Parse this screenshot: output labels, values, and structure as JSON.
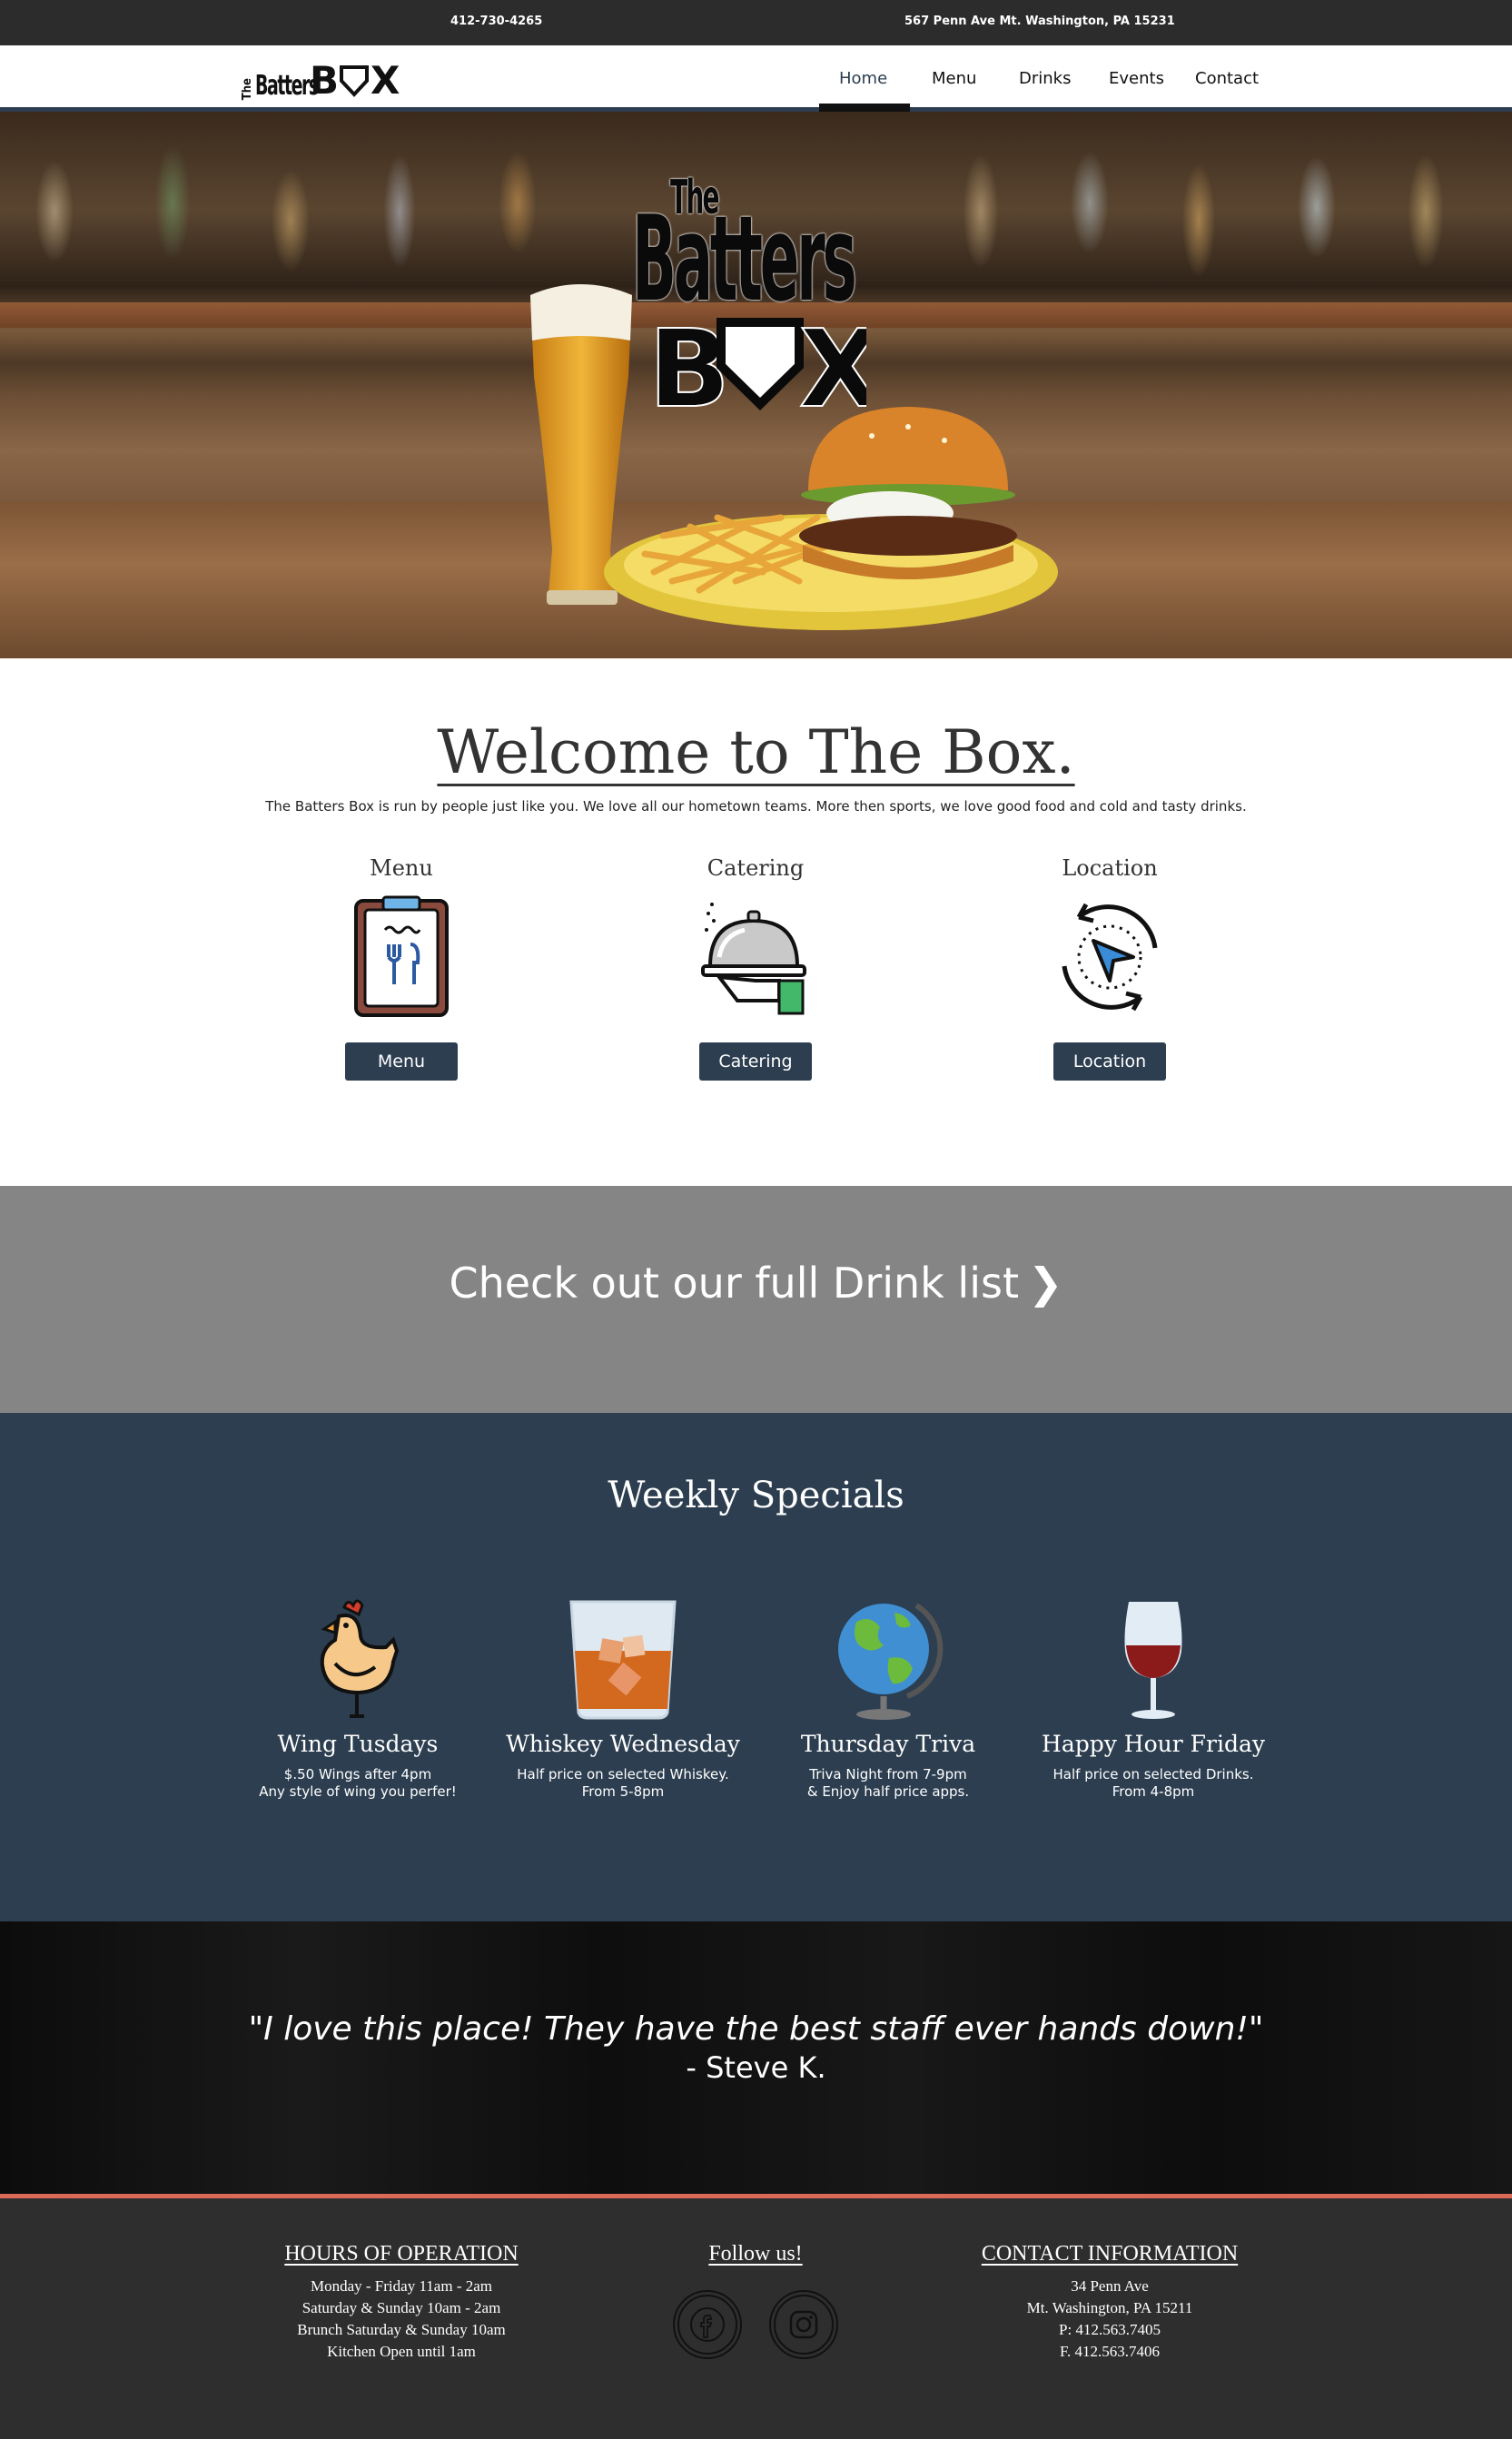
{
  "topbar": {
    "phone": "412-730-4265",
    "address": "567 Penn Ave Mt. Washington, PA 15231"
  },
  "brand": {
    "logo_the": "The",
    "logo_batters": "Batters",
    "logo_box_b": "B",
    "logo_box_x": "X"
  },
  "nav": {
    "items": [
      {
        "label": "Home",
        "active": true
      },
      {
        "label": "Menu"
      },
      {
        "label": "Drinks"
      },
      {
        "label": "Events"
      },
      {
        "label": "Contact"
      }
    ]
  },
  "welcome": {
    "title": "Welcome to The Box.",
    "text": "The Batters Box is run by people just like you. We love all our hometown teams. More then sports, we love good food and cold and tasty drinks."
  },
  "features": [
    {
      "title": "Menu",
      "button": "Menu",
      "icon": "menu-clipboard-icon"
    },
    {
      "title": "Catering",
      "button": "Catering",
      "icon": "catering-cloche-icon"
    },
    {
      "title": "Location",
      "button": "Location",
      "icon": "location-arrow-icon"
    }
  ],
  "drink_banner": {
    "label": "Check out our full Drink list",
    "chevron": "❯"
  },
  "specials": {
    "title": "Weekly Specials",
    "items": [
      {
        "title": "Wing Tusdays",
        "desc": "$.50 Wings after 4pm\nAny style of wing you perfer!",
        "icon": "chicken-icon"
      },
      {
        "title": "Whiskey Wednesday",
        "desc": "Half price on selected Whiskey.\nFrom 5-8pm",
        "icon": "whiskey-glass-icon"
      },
      {
        "title": "Thursday Triva",
        "desc": "Triva Night from 7-9pm\n& Enjoy half price apps.",
        "icon": "globe-icon"
      },
      {
        "title": "Happy Hour Friday",
        "desc": "Half price on selected Drinks.\nFrom 4-8pm",
        "icon": "wine-glass-icon"
      }
    ]
  },
  "testimonial": {
    "quote": "\"I love this place! They have the best staff ever hands down!\"",
    "author": "- Steve K."
  },
  "footer": {
    "hours": {
      "heading": "HOURS OF OPERATION",
      "lines": [
        "Monday - Friday 11am - 2am",
        "Saturday & Sunday 10am - 2am",
        "Brunch Saturday & Sunday 10am",
        "Kitchen Open until 1am"
      ]
    },
    "follow": {
      "heading": "Follow us!",
      "icons": [
        "facebook-icon",
        "instagram-icon"
      ]
    },
    "contact": {
      "heading": "CONTACT INFORMATION",
      "lines": [
        "34 Penn Ave",
        "Mt. Washington, PA 15211",
        "P: 412.563.7405",
        "F. 412.563.7406"
      ]
    }
  },
  "colors": {
    "topbar": "#2c2c2c",
    "primary": "#2c3e50",
    "drink_banner": "#858585",
    "accent": "#d96a57",
    "footer": "#2e2e2e"
  }
}
